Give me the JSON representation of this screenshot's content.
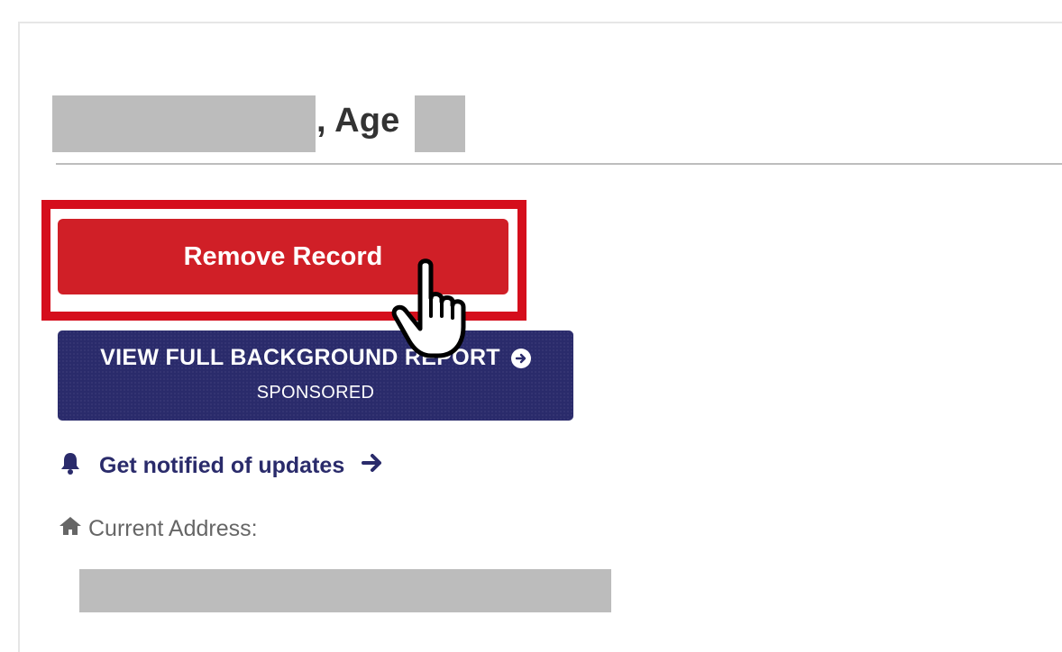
{
  "person": {
    "age_label": ", Age"
  },
  "actions": {
    "remove_label": "Remove Record",
    "report_label": "VIEW FULL BACKGROUND REPORT",
    "report_sub": "SPONSORED",
    "notify_label": "Get notified of updates"
  },
  "address": {
    "label": "Current Address:"
  },
  "colors": {
    "remove": "#d01f27",
    "highlight": "#d50e1c",
    "report": "#2a2b6b",
    "notify": "#2a2b6b",
    "redaction": "#bcbcbc"
  },
  "icons": {
    "report_arrow": "circle-arrow-right-icon",
    "bell": "bell-icon",
    "notify_arrow": "arrow-right-icon",
    "home": "home-icon",
    "cursor": "hand-pointer-icon"
  }
}
